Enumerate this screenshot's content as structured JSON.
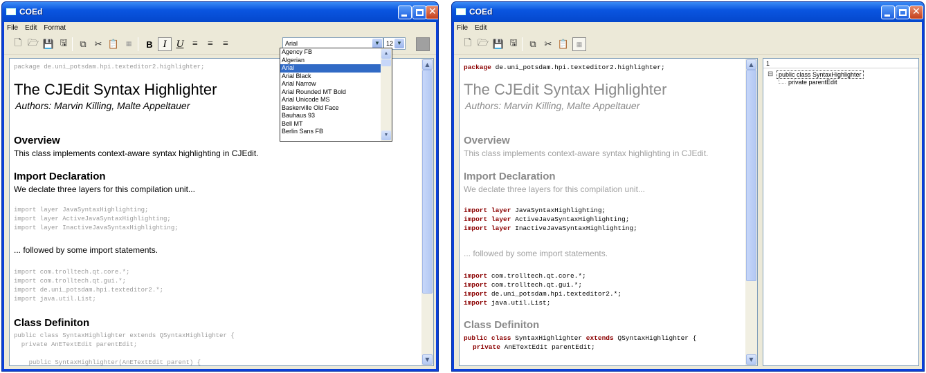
{
  "left": {
    "title": "COEd",
    "menu": [
      "File",
      "Edit",
      "Format"
    ],
    "font_combo": "Arial",
    "size_combo": "12",
    "format_buttons": {
      "bold": "B",
      "italic": "I",
      "underline": "U"
    },
    "font_list": [
      "Agency FB",
      "Algerian",
      "Arial",
      "Arial Black",
      "Arial Narrow",
      "Arial Rounded MT Bold",
      "Arial Unicode MS",
      "Baskerville Old Face",
      "Bauhaus 93",
      "Bell MT",
      "Berlin Sans FB"
    ],
    "font_selected_index": 2,
    "doc": {
      "package": "package de.uni_potsdam.hpi.texteditor2.highlighter;",
      "h1": "The CJEdit Syntax Highlighter",
      "authors": "Authors: Marvin Killing, Malte Appeltauer",
      "overview_h": "Overview",
      "overview_p": "This class implements context-aware syntax highlighting in CJEdit.",
      "import_h": "Import Declaration",
      "import_p": "We declate three layers for this compilation unit...",
      "layers": [
        "import layer JavaSyntaxHighlighting;",
        "import layer ActiveJavaSyntaxHighlighting;",
        "import layer InactiveJavaSyntaxHighlighting;"
      ],
      "followed": "... followed by some import statements.",
      "imports": [
        "import com.trolltech.qt.core.*;",
        "import com.trolltech.qt.gui.*;",
        "import de.uni_potsdam.hpi.texteditor2.*;",
        "import java.util.List;"
      ],
      "class_h": "Class Definiton",
      "class_lines": [
        "public class SyntaxHighlighter extends QSyntaxHighlighter {",
        "  private AnETextEdit parentEdit;",
        "",
        "    public SyntaxHighlighter(AnETextEdit parent) {"
      ]
    }
  },
  "right": {
    "title": "COEd",
    "menu": [
      "File",
      "Edit"
    ],
    "doc": {
      "package_kw": "package",
      "package_rest": " de.uni_potsdam.hpi.texteditor2.highlighter;",
      "h1": "The CJEdit Syntax Highlighter",
      "authors": "Authors: Marvin Killing, Malte Appeltauer",
      "overview_h": "Overview",
      "overview_p": "This class implements context-aware syntax highlighting in CJEdit.",
      "import_h": "Import Declaration",
      "import_p": "We declate three layers for this compilation unit...",
      "kw_import": "import",
      "kw_layer": "layer",
      "layer_names": [
        " JavaSyntaxHighlighting;",
        " ActiveJavaSyntaxHighlighting;",
        " InactiveJavaSyntaxHighlighting;"
      ],
      "followed": "... followed by some import statements.",
      "import_names": [
        " com.trolltech.qt.core.*;",
        " com.trolltech.qt.gui.*;",
        " de.uni_potsdam.hpi.texteditor2.*;",
        " java.util.List;"
      ],
      "class_h": "Class Definiton",
      "kw_public": "public",
      "kw_class": "class",
      "class_name": " SyntaxHighlighter ",
      "kw_extends": "extends",
      "class_rest": " QSyntaxHighlighter {",
      "kw_private": "private",
      "field_rest": " AnETextEdit parentEdit;"
    },
    "tree": {
      "header": "1",
      "root": "public class SyntaxHighlighter",
      "child": "private parentEdit",
      "expander": "⊟"
    }
  },
  "colors": {
    "keyword": "#8b0000",
    "titlebar": "#0a55e0",
    "selection": "#316ac5"
  }
}
